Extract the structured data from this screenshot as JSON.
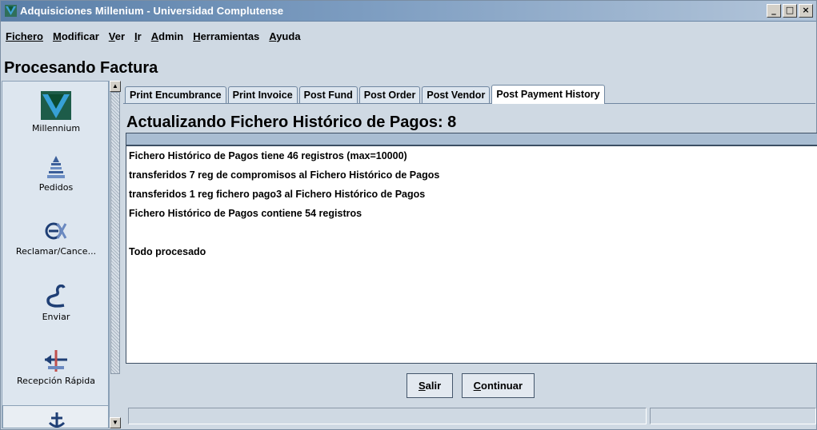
{
  "window": {
    "title": "Adquisiciones Millenium - Universidad Complutense",
    "controls": {
      "minimize": "_",
      "maximize": "□",
      "close": "×"
    }
  },
  "menu": [
    {
      "label": "Fichero"
    },
    {
      "label": "Modificar"
    },
    {
      "label": "Ver"
    },
    {
      "label": "Ir"
    },
    {
      "label": "Admin"
    },
    {
      "label": "Herramientas"
    },
    {
      "label": "Ayuda"
    }
  ],
  "page": {
    "title": "Procesando Factura"
  },
  "sidebar": {
    "items": [
      {
        "label": "Millennium",
        "icon": "millennium-logo-icon"
      },
      {
        "label": "Pedidos",
        "icon": "pedidos-icon"
      },
      {
        "label": "Reclamar/Cance...",
        "icon": "reclamar-icon"
      },
      {
        "label": "Enviar",
        "icon": "enviar-icon"
      },
      {
        "label": "Recepción Rápida",
        "icon": "recepcion-icon"
      }
    ]
  },
  "tabs": [
    {
      "label": "Print Encumbrance",
      "active": false
    },
    {
      "label": "Print Invoice",
      "active": false
    },
    {
      "label": "Post Fund",
      "active": false
    },
    {
      "label": "Post Order",
      "active": false
    },
    {
      "label": "Post Vendor",
      "active": false
    },
    {
      "label": "Post Payment History",
      "active": true
    }
  ],
  "panel": {
    "title": "Actualizando Fichero Histórico de Pagos: 8",
    "progress": 1.0,
    "log": [
      "Fichero Histórico de Pagos tiene 46 registros (max=10000)",
      "transferidos 7 reg de compromisos al Fichero Histórico de Pagos",
      "transferidos 1 reg fichero pago3 al Fichero Histórico de Pagos",
      "Fichero Histórico de Pagos contiene 54 registros",
      "",
      "Todo procesado"
    ]
  },
  "buttons": {
    "salir": "Salir",
    "continuar": "Continuar"
  },
  "colors": {
    "accent": "#5a7fa8",
    "window_bg": "#cfd9e3",
    "progress": "#a9bdd2"
  }
}
